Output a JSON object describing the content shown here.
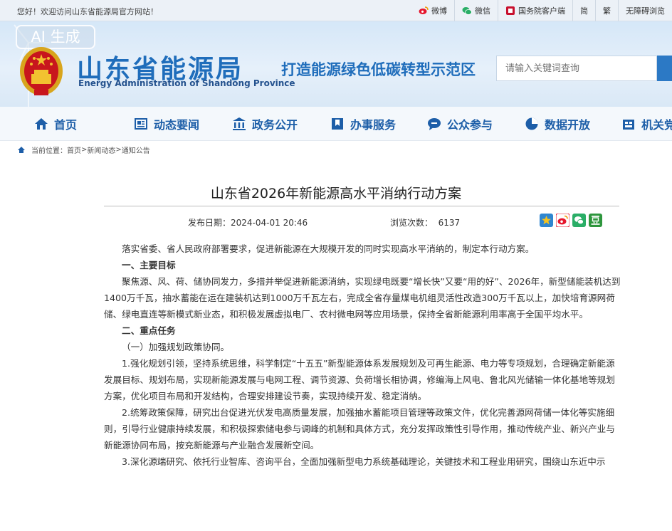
{
  "topbar": {
    "welcome": "您好！欢迎访问山东省能源局官方网站！",
    "links": [
      {
        "name": "weibo",
        "label": "微博",
        "icon": "weibo-icon"
      },
      {
        "name": "wechat",
        "label": "微信",
        "icon": "wechat-icon"
      },
      {
        "name": "guowuyuan",
        "label": "国务院客户端",
        "icon": "app-client-icon"
      },
      {
        "name": "simplified",
        "label": "简"
      },
      {
        "name": "traditional",
        "label": "繁"
      },
      {
        "name": "accessibility",
        "label": "无障碍浏览"
      }
    ]
  },
  "header": {
    "ai_tag": "AI 生成",
    "title": "山东省能源局",
    "subtitle": "Energy Administration of Shandong Province",
    "slogan": "打造能源绿色低碳转型示范区",
    "search_placeholder": "请输入关键词查询"
  },
  "nav": [
    {
      "name": "home",
      "label": "首页",
      "icon": "home-icon"
    },
    {
      "name": "news",
      "label": "动态要闻",
      "icon": "newspaper-icon"
    },
    {
      "name": "gov-affairs",
      "label": "政务公开",
      "icon": "building-icon"
    },
    {
      "name": "services",
      "label": "办事服务",
      "icon": "bookmark-icon"
    },
    {
      "name": "participation",
      "label": "公众参与",
      "icon": "chat-icon"
    },
    {
      "name": "open-data",
      "label": "数据开放",
      "icon": "pie-chart-icon"
    },
    {
      "name": "organization",
      "label": "机关党建",
      "icon": "office-icon"
    }
  ],
  "breadcrumb": {
    "prefix": "当前位置：",
    "items": [
      "首页",
      "新闻动态",
      "通知公告"
    ],
    "separator": ">"
  },
  "article": {
    "title": "山东省2026年新能源高水平消纳行动方案",
    "publish_label": "发布日期：",
    "publish_date": "2024-04-01 20:46",
    "views_label": "浏览次数：",
    "views": "6137",
    "share_icons": [
      "favorite-star-icon",
      "weibo-share-icon",
      "wechat-share-icon",
      "douban-share-icon"
    ],
    "paragraphs": [
      {
        "type": "indent",
        "text": "落实省委、省人民政府部署要求，促进新能源在大规模开发的同时实现高水平消纳的，制定本行动方案。"
      },
      {
        "type": "head",
        "text": "一、主要目标"
      },
      {
        "type": "indent",
        "text": "聚焦源、风、荷、储协同发力，多措并举促进新能源消纳，实现绿电既要“增长快”又要“用的好”、2026年，新型储能装机达到1400万千瓦，抽水蓄能在运在建装机达到1000万千瓦左右，完成全省存量煤电机组灵活性改造300万千瓦以上，加快培育源网荷储、绿电直连等新模式新业态，和积极发展虚拟电厂、农村微电网等应用场景，保持全省新能源利用率高于全国平均水平。"
      },
      {
        "type": "head",
        "text": "二、重点任务"
      },
      {
        "type": "indent",
        "text": "（一）加强规划政策协同。"
      },
      {
        "type": "indent",
        "text": "1.强化规划引领，坚持系统思维，科学制定“十五五”新型能源体系发展规划及可再生能源、电力等专项规划，合理确定新能源发展目标、规划布局，实现新能源发展与电网工程、调节资源、负荷增长相协调，修编海上风电、鲁北风光储输一体化基地等规划方案，优化项目布局和开发结构，合理安排建设节奏，实现持续开发、稳定消纳。"
      },
      {
        "type": "indent",
        "text": "2.统筹政策保障，研究出台促进光伏发电高质量发展，加强抽水蓄能项目管理等政策文件，优化完善源网荷储一体化等实施细则，引导行业健康持续发展，和积极探索储电参与调峰的机制和具体方式，充分发挥政策性引导作用，推动传统产业、新兴产业与新能源协同布局，按充新能源与产业融合发展新空间。"
      },
      {
        "type": "indent",
        "text": "3.深化源端研究、依托行业智库、咨询平台，全面加强新型电力系统基础理论，关键技术和工程业用研究，围绕山东近中示"
      }
    ]
  },
  "colors": {
    "brand_blue": "#1f6dbb",
    "nav_blue": "#1d5ea8",
    "header_bg": "#d5e7f8"
  }
}
